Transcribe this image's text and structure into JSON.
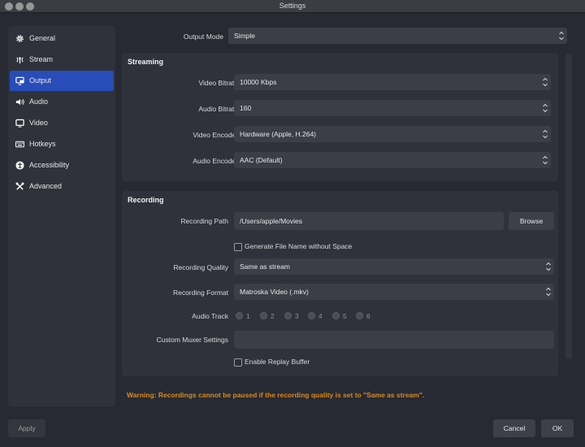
{
  "window": {
    "title": "Settings",
    "traffic_colors": [
      "#ff5f57",
      "#febc2e",
      "#28c840"
    ]
  },
  "sidebar": {
    "items": [
      {
        "label": "General",
        "icon": "gear-icon"
      },
      {
        "label": "Stream",
        "icon": "antenna-icon"
      },
      {
        "label": "Output",
        "icon": "monitor-output-icon",
        "active": true
      },
      {
        "label": "Audio",
        "icon": "speaker-icon"
      },
      {
        "label": "Video",
        "icon": "display-icon"
      },
      {
        "label": "Hotkeys",
        "icon": "keyboard-icon"
      },
      {
        "label": "Accessibility",
        "icon": "accessibility-icon"
      },
      {
        "label": "Advanced",
        "icon": "tools-icon"
      }
    ]
  },
  "output_mode": {
    "label": "Output Mode",
    "value": "Simple"
  },
  "streaming": {
    "title": "Streaming",
    "video_bitrate": {
      "label": "Video Bitrate",
      "value": "10000 Kbps"
    },
    "audio_bitrate": {
      "label": "Audio Bitrate",
      "value": "160"
    },
    "video_encoder": {
      "label": "Video Encoder",
      "value": "Hardware (Apple, H.264)"
    },
    "audio_encoder": {
      "label": "Audio Encoder",
      "value": "AAC (Default)"
    }
  },
  "recording": {
    "title": "Recording",
    "path": {
      "label": "Recording Path",
      "value": "/Users/apple/Movies",
      "browse": "Browse"
    },
    "generate_name": {
      "label": "Generate File Name without Space",
      "checked": false
    },
    "quality": {
      "label": "Recording Quality",
      "value": "Same as stream"
    },
    "format": {
      "label": "Recording Format",
      "value": "Matroska Video (.mkv)"
    },
    "audio_track": {
      "label": "Audio Track",
      "options": [
        "1",
        "2",
        "3",
        "4",
        "5",
        "6"
      ]
    },
    "muxer": {
      "label": "Custom Muxer Settings",
      "value": ""
    },
    "replay_buffer": {
      "label": "Enable Replay Buffer",
      "checked": false
    }
  },
  "warning": "Warning: Recordings cannot be paused if the recording quality is set to \"Same as stream\".",
  "buttons": {
    "apply": "Apply",
    "cancel": "Cancel",
    "ok": "OK"
  },
  "colors": {
    "accent": "#284cb8",
    "warning": "#d98a1c",
    "panel": "#2f323a",
    "background": "#272a33"
  }
}
